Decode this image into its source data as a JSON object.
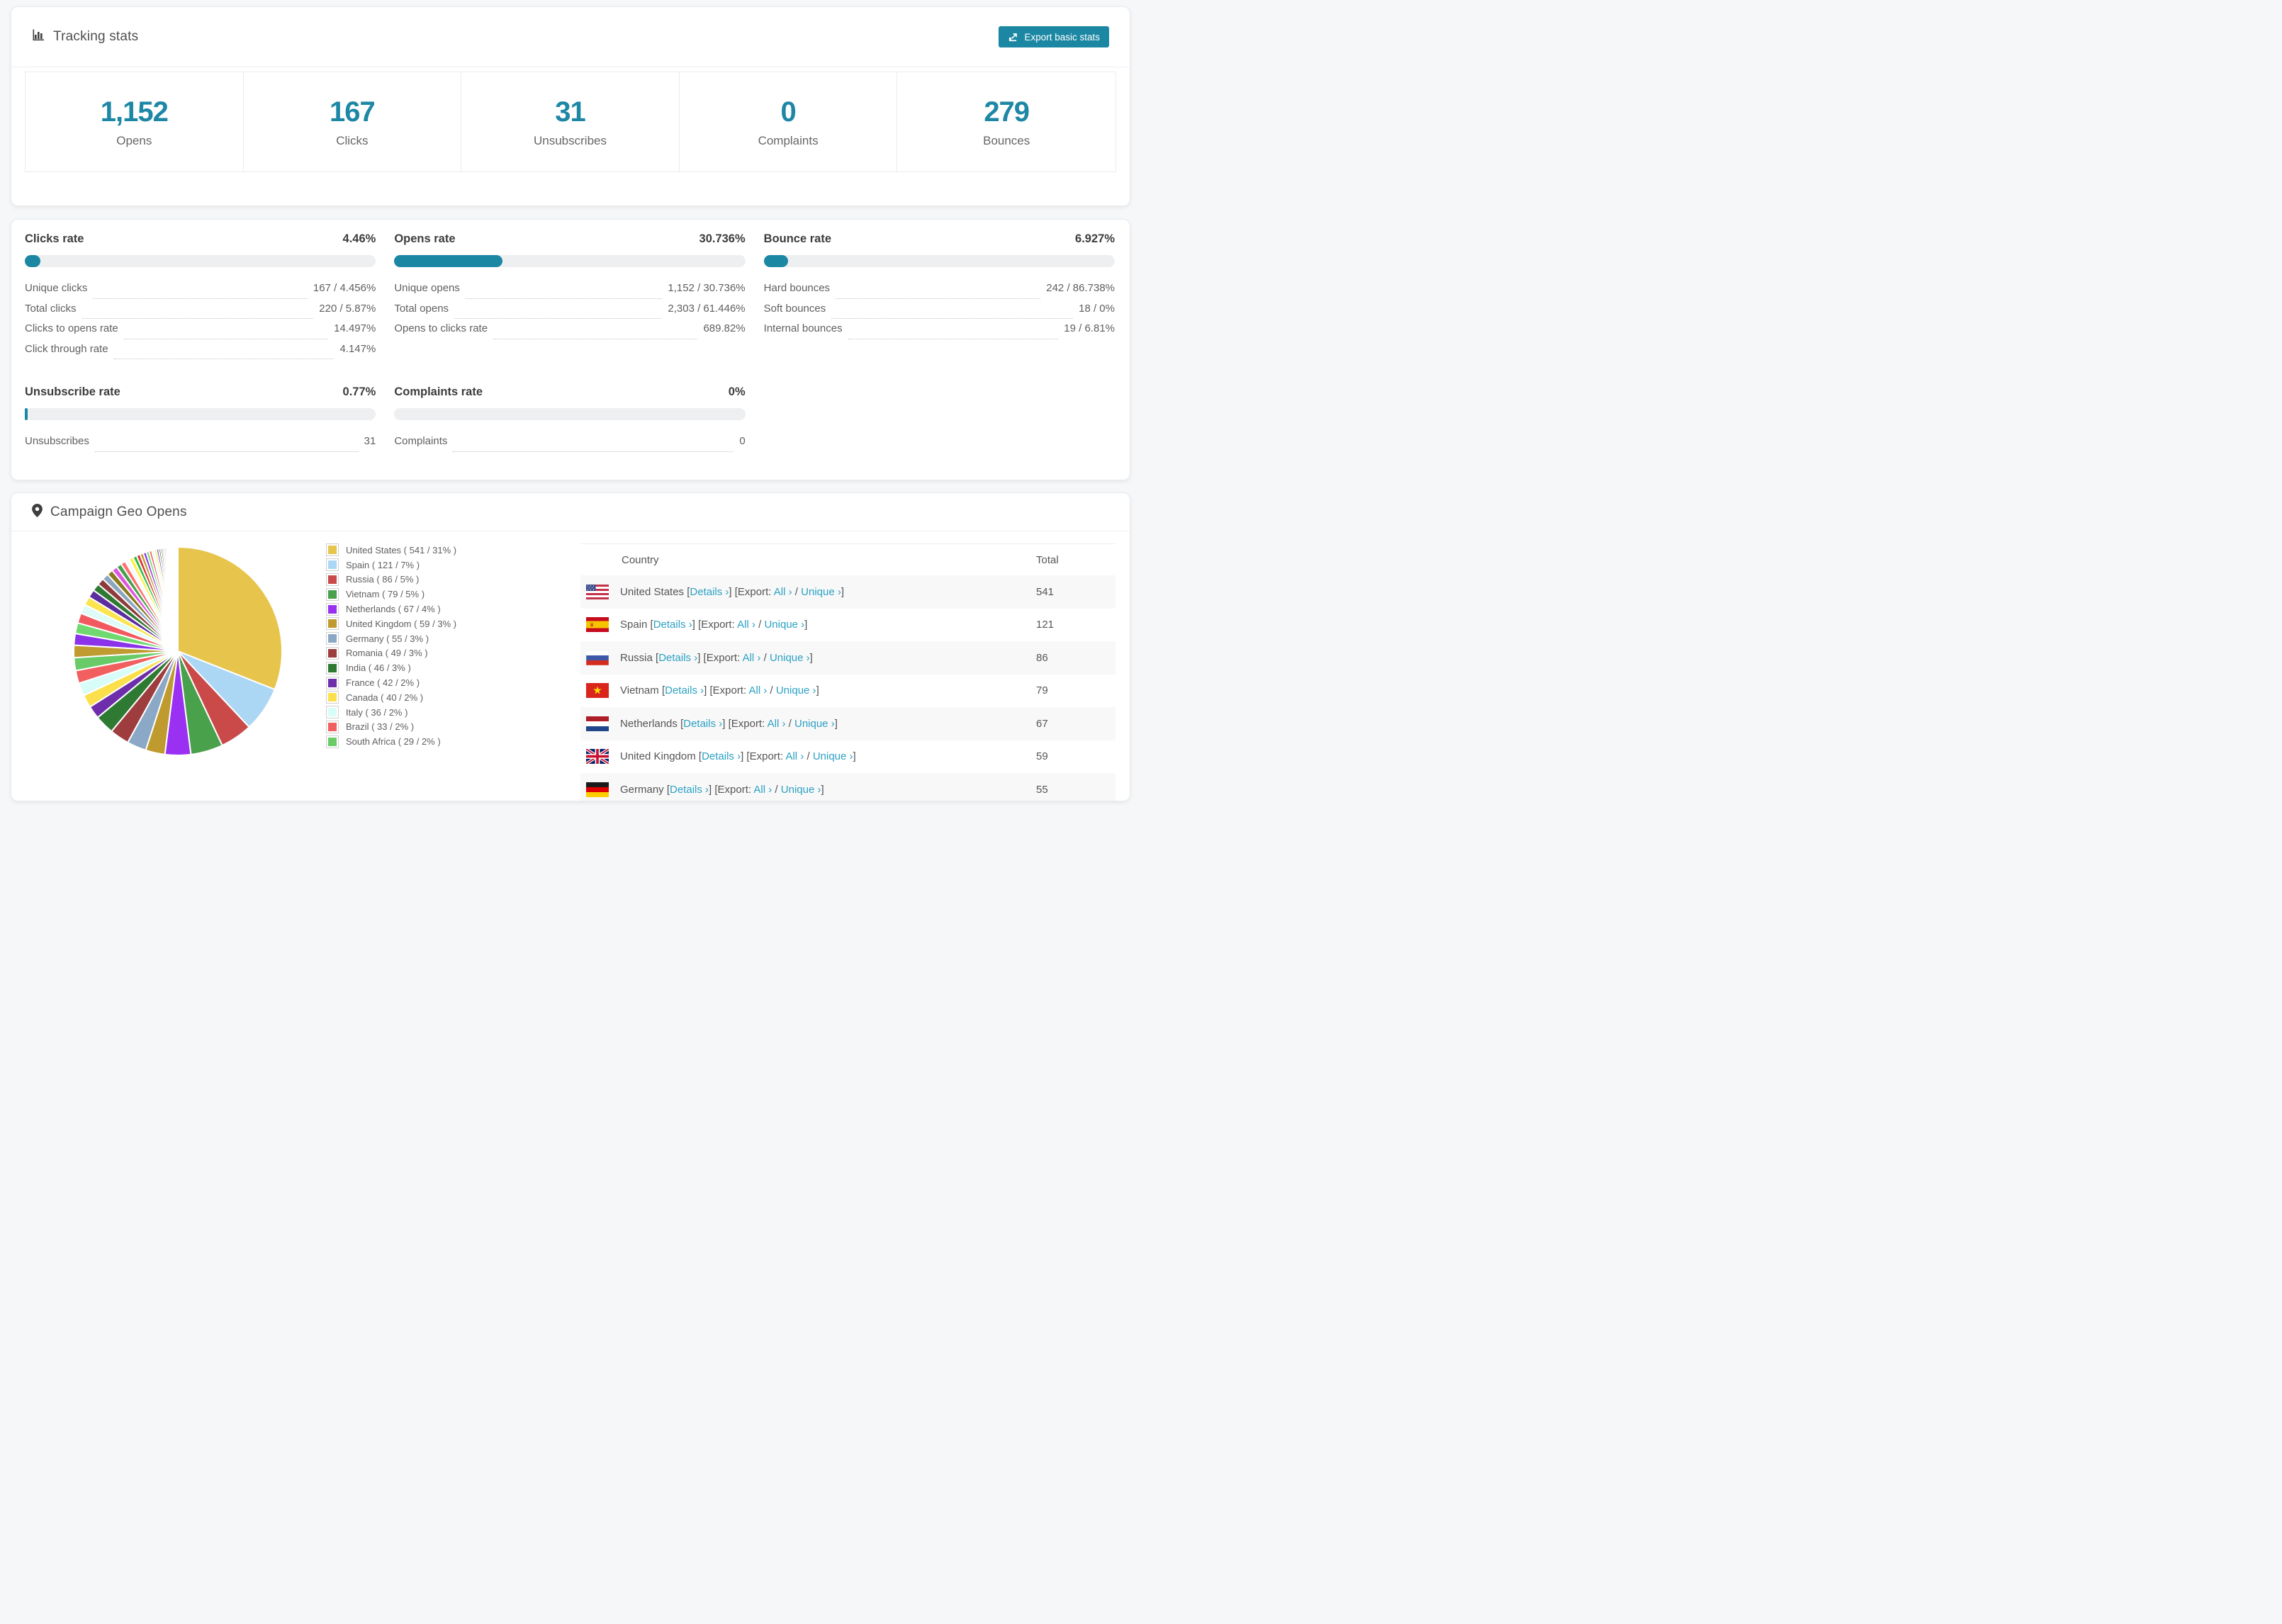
{
  "tracking": {
    "title": "Tracking stats",
    "export_label": "Export basic stats",
    "summary": [
      {
        "value": "1,152",
        "label": "Opens"
      },
      {
        "value": "167",
        "label": "Clicks"
      },
      {
        "value": "31",
        "label": "Unsubscribes"
      },
      {
        "value": "0",
        "label": "Complaints"
      },
      {
        "value": "279",
        "label": "Bounces"
      }
    ]
  },
  "rates": [
    {
      "title": "Clicks rate",
      "value": "4.46%",
      "percent": 4.46,
      "rows": [
        {
          "label": "Unique clicks",
          "value": "167 / 4.456%"
        },
        {
          "label": "Total clicks",
          "value": "220 / 5.87%"
        },
        {
          "label": "Clicks to opens rate",
          "value": "14.497%"
        },
        {
          "label": "Click through rate",
          "value": "4.147%"
        }
      ]
    },
    {
      "title": "Opens rate",
      "value": "30.736%",
      "percent": 30.736,
      "rows": [
        {
          "label": "Unique opens",
          "value": "1,152 / 30.736%"
        },
        {
          "label": "Total opens",
          "value": "2,303 / 61.446%"
        },
        {
          "label": "Opens to clicks rate",
          "value": "689.82%"
        }
      ]
    },
    {
      "title": "Bounce rate",
      "value": "6.927%",
      "percent": 6.927,
      "rows": [
        {
          "label": "Hard bounces",
          "value": "242 / 86.738%"
        },
        {
          "label": "Soft bounces",
          "value": "18 / 0%"
        },
        {
          "label": "Internal bounces",
          "value": "19 / 6.81%"
        }
      ]
    },
    {
      "title": "Unsubscribe rate",
      "value": "0.77%",
      "percent": 0.77,
      "rows": [
        {
          "label": "Unsubscribes",
          "value": "31"
        }
      ]
    },
    {
      "title": "Complaints rate",
      "value": "0%",
      "percent": 0,
      "rows": [
        {
          "label": "Complaints",
          "value": "0"
        }
      ]
    }
  ],
  "geo": {
    "title": "Campaign Geo Opens",
    "table": {
      "columns": [
        "Country",
        "Total"
      ],
      "link_labels": {
        "details": "Details ›",
        "export_prefix": "Export:",
        "all": "All ›",
        "separator": "/",
        "unique": "Unique ›"
      },
      "rows": [
        {
          "country": "United States",
          "total": "541",
          "flag": "us"
        },
        {
          "country": "Spain",
          "total": "121",
          "flag": "es"
        },
        {
          "country": "Russia",
          "total": "86",
          "flag": "ru"
        },
        {
          "country": "Vietnam",
          "total": "79",
          "flag": "vn"
        },
        {
          "country": "Netherlands",
          "total": "67",
          "flag": "nl"
        },
        {
          "country": "United Kingdom",
          "total": "59",
          "flag": "gb"
        },
        {
          "country": "Germany",
          "total": "55",
          "flag": "de",
          "partial": true
        }
      ]
    }
  },
  "chart_data": {
    "type": "pie",
    "title": "Campaign Geo Opens",
    "unit": "opens",
    "legend_position": "right",
    "start_angle_deg": 0,
    "direction": "clockwise",
    "series": [
      {
        "name": "United States",
        "value": 541,
        "percent": 31,
        "color": "#e7c44c",
        "legend_label": "United States ( 541 / 31% )"
      },
      {
        "name": "Spain",
        "value": 121,
        "percent": 7,
        "color": "#abd7f4",
        "legend_label": "Spain ( 121 / 7% )"
      },
      {
        "name": "Russia",
        "value": 86,
        "percent": 5,
        "color": "#ca4a4a",
        "legend_label": "Russia ( 86 / 5% )"
      },
      {
        "name": "Vietnam",
        "value": 79,
        "percent": 5,
        "color": "#49a14b",
        "legend_label": "Vietnam ( 79 / 5% )"
      },
      {
        "name": "Netherlands",
        "value": 67,
        "percent": 4,
        "color": "#9a30f2",
        "legend_label": "Netherlands ( 67 / 4% )"
      },
      {
        "name": "United Kingdom",
        "value": 59,
        "percent": 3,
        "color": "#bf9a2e",
        "legend_label": "United Kingdom ( 59 / 3% )"
      },
      {
        "name": "Germany",
        "value": 55,
        "percent": 3,
        "color": "#8ba9c6",
        "legend_label": "Germany ( 55 / 3% )"
      },
      {
        "name": "Romania",
        "value": 49,
        "percent": 3,
        "color": "#9e3d3d",
        "legend_label": "Romania ( 49 / 3% )"
      },
      {
        "name": "India",
        "value": 46,
        "percent": 3,
        "color": "#2f7a33",
        "legend_label": "India ( 46 / 3% )"
      },
      {
        "name": "France",
        "value": 42,
        "percent": 2,
        "color": "#6e2daa",
        "legend_label": "France ( 42 / 2% )"
      },
      {
        "name": "Canada",
        "value": 40,
        "percent": 2,
        "color": "#fbe04b",
        "legend_label": "Canada ( 40 / 2% )"
      },
      {
        "name": "Italy",
        "value": 36,
        "percent": 2,
        "color": "#d8fcf8",
        "legend_label": "Italy ( 36 / 2% )"
      },
      {
        "name": "Brazil",
        "value": 33,
        "percent": 2,
        "color": "#f25f5f",
        "legend_label": "Brazil ( 33 / 2% )"
      },
      {
        "name": "South Africa",
        "value": 29,
        "percent": 2,
        "color": "#68cb68",
        "legend_label": "South Africa ( 29 / 2% )"
      }
    ],
    "others": {
      "percent_total": 26,
      "slice_count": 40,
      "decay": 0.93,
      "palette": [
        "#bf9b30",
        "#8b33e8",
        "#6fd96f",
        "#f2595f",
        "#dffbf7",
        "#fbe44d",
        "#5b2d9e",
        "#2f7a33",
        "#8e3b3b",
        "#8ca6c0",
        "#8a7a1f",
        "#e055e0",
        "#49a14b",
        "#ff7070",
        "#f4fdfc",
        "#fdf04a",
        "#33bb44",
        "#e03131"
      ]
    },
    "accent_color": "#1b87a3"
  }
}
